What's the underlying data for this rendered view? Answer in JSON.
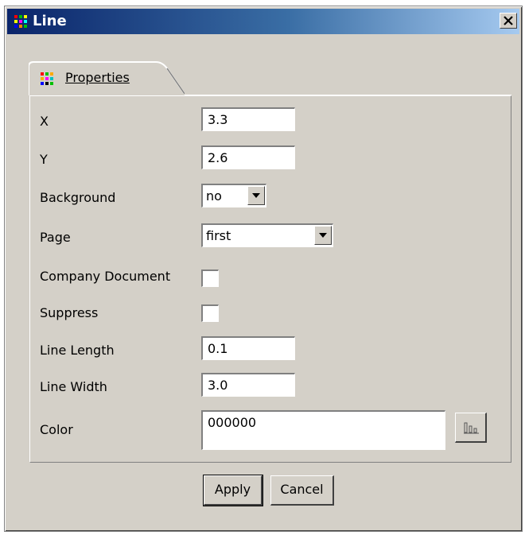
{
  "window": {
    "title": "Line",
    "title_icon": "grid-icon",
    "close_icon": "close-icon"
  },
  "tabs": [
    {
      "label": "Properties",
      "icon": "grid-icon",
      "active": true
    }
  ],
  "fields": {
    "x": {
      "label": "X",
      "value": "3.3"
    },
    "y": {
      "label": "Y",
      "value": "2.6"
    },
    "background": {
      "label": "Background",
      "value": "no"
    },
    "page": {
      "label": "Page",
      "value": "first"
    },
    "company_document": {
      "label": "Company Document",
      "checked": false
    },
    "suppress": {
      "label": "Suppress",
      "checked": false
    },
    "line_length": {
      "label": "Line Length",
      "value": "0.1"
    },
    "line_width": {
      "label": "Line Width",
      "value": "3.0"
    },
    "color": {
      "label": "Color",
      "value": "000000",
      "picker_icon": "color-picker-icon"
    }
  },
  "buttons": {
    "apply": "Apply",
    "cancel": "Cancel"
  },
  "colors": {
    "titlebar_start": "#0a246a",
    "titlebar_end": "#a6caf0",
    "window_bg": "#d4d0c8"
  }
}
